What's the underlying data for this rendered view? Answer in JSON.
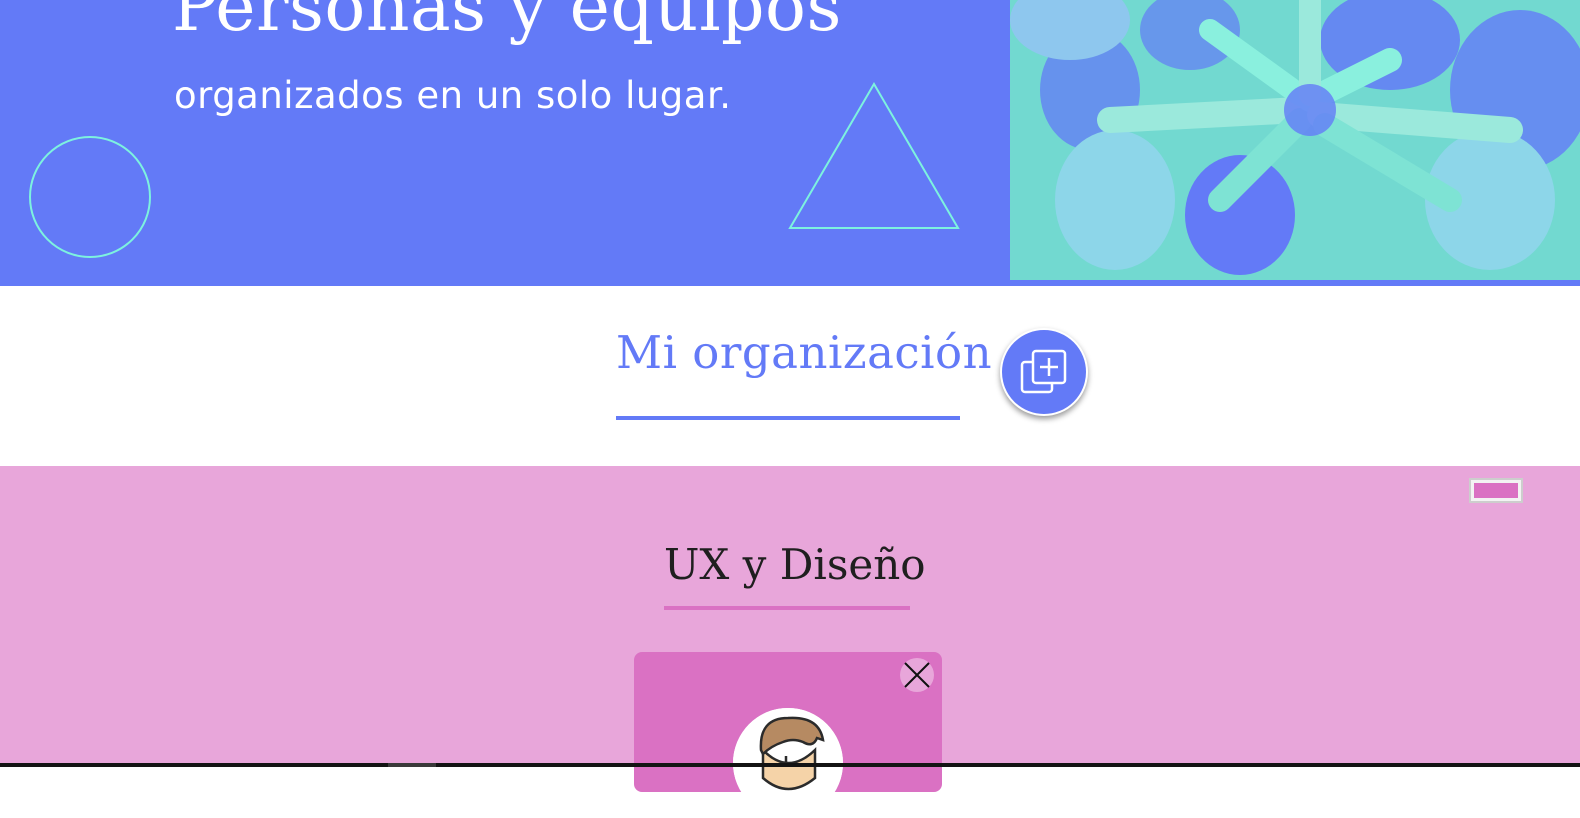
{
  "hero": {
    "title": "Personas y equipos",
    "subtitle": "organizados en un solo lugar."
  },
  "organization": {
    "title": "Mi organización",
    "add_icon": "add-copy-icon"
  },
  "team": {
    "name": "UX y Diseño",
    "close_icon": "close-icon",
    "avatar_icon": "user-avatar-icon"
  },
  "colors": {
    "primary": "#637af7",
    "accent": "#7df2df",
    "team_bg": "#e8a6da",
    "team_accent": "#da71c3"
  }
}
